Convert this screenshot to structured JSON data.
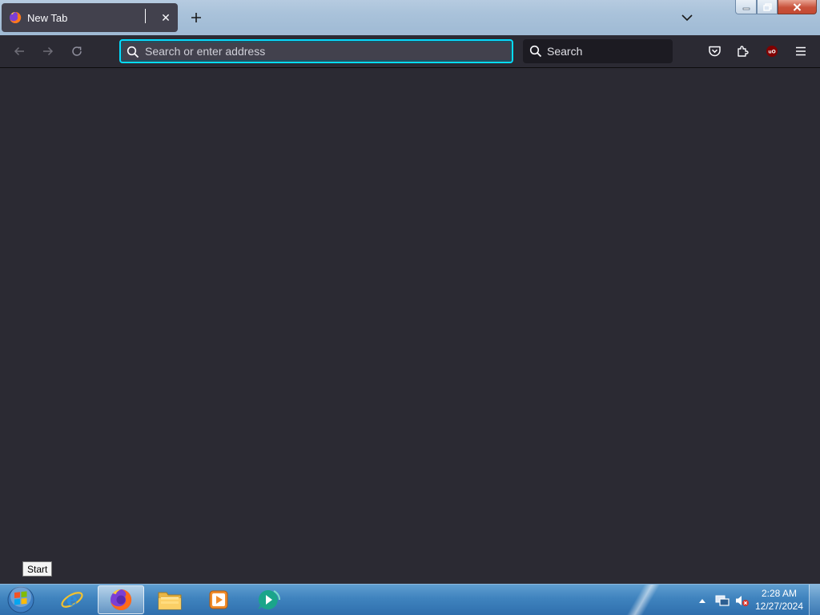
{
  "browser": {
    "tab": {
      "title": "New Tab",
      "close_glyph": "✕"
    },
    "newtab_glyph": "+",
    "urlbar": {
      "placeholder": "Search or enter address",
      "value": ""
    },
    "searchbar": {
      "placeholder": "Search"
    },
    "extension_badge": "uO"
  },
  "colors": {
    "toolbar_bg": "#2b2a33",
    "tab_bg": "#42414d",
    "focus_ring": "#00ddff",
    "text": "#fbfbfe"
  },
  "tooltip": {
    "text": "Start"
  },
  "taskbar": {
    "apps": [
      {
        "name": "internet-explorer-icon"
      },
      {
        "name": "firefox-icon",
        "active": true
      },
      {
        "name": "file-explorer-icon"
      },
      {
        "name": "media-player-icon"
      },
      {
        "name": "chat-app-icon"
      }
    ],
    "clock": {
      "time": "2:28 AM",
      "date": "12/27/2024"
    }
  }
}
